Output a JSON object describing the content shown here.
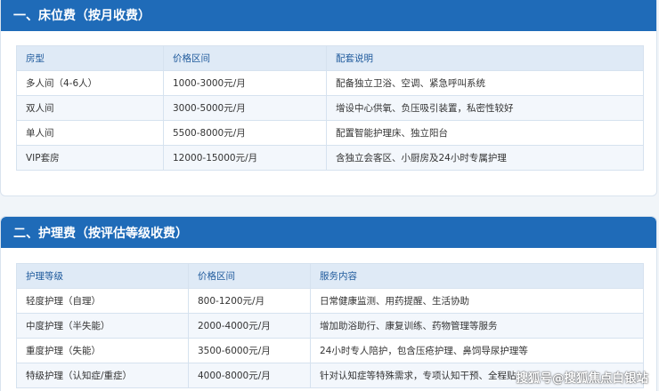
{
  "colors": {
    "header_bg": "#1f6bb8",
    "table_head_bg": "#dfeaf6",
    "table_head_text": "#1f5a9c",
    "row_alt_bg": "#f3f7fc"
  },
  "section1": {
    "title": "一、床位费（按月收费）",
    "headers": [
      "房型",
      "价格区间",
      "配套说明"
    ],
    "rows": [
      [
        "多人间（4-6人）",
        "1000-3000元/月",
        "配备独立卫浴、空调、紧急呼叫系统"
      ],
      [
        "双人间",
        "3000-5000元/月",
        "增设中心供氧、负压吸引装置，私密性较好"
      ],
      [
        "单人间",
        "5500-8000元/月",
        "配置智能护理床、独立阳台"
      ],
      [
        "VIP套房",
        "12000-15000元/月",
        "含独立会客区、小厨房及24小时专属护理"
      ]
    ]
  },
  "section2": {
    "title": "二、护理费（按评估等级收费）",
    "headers": [
      "护理等级",
      "价格区间",
      "服务内容"
    ],
    "rows": [
      [
        "轻度护理（自理）",
        "800-1200元/月",
        "日常健康监测、用药提醒、生活协助"
      ],
      [
        "中度护理（半失能）",
        "2000-4000元/月",
        "增加助浴助行、康复训练、药物管理等服务"
      ],
      [
        "重度护理（失能）",
        "3500-6000元/月",
        "24小时专人陪护，包含压疮护理、鼻饲导尿护理等"
      ],
      [
        "特级护理（认知症/重症）",
        "4000-8000元/月",
        "针对认知症等特殊需求，专项认知干预、全程贴"
      ]
    ]
  },
  "watermark": "搜狐号@搜狐焦点白银站"
}
